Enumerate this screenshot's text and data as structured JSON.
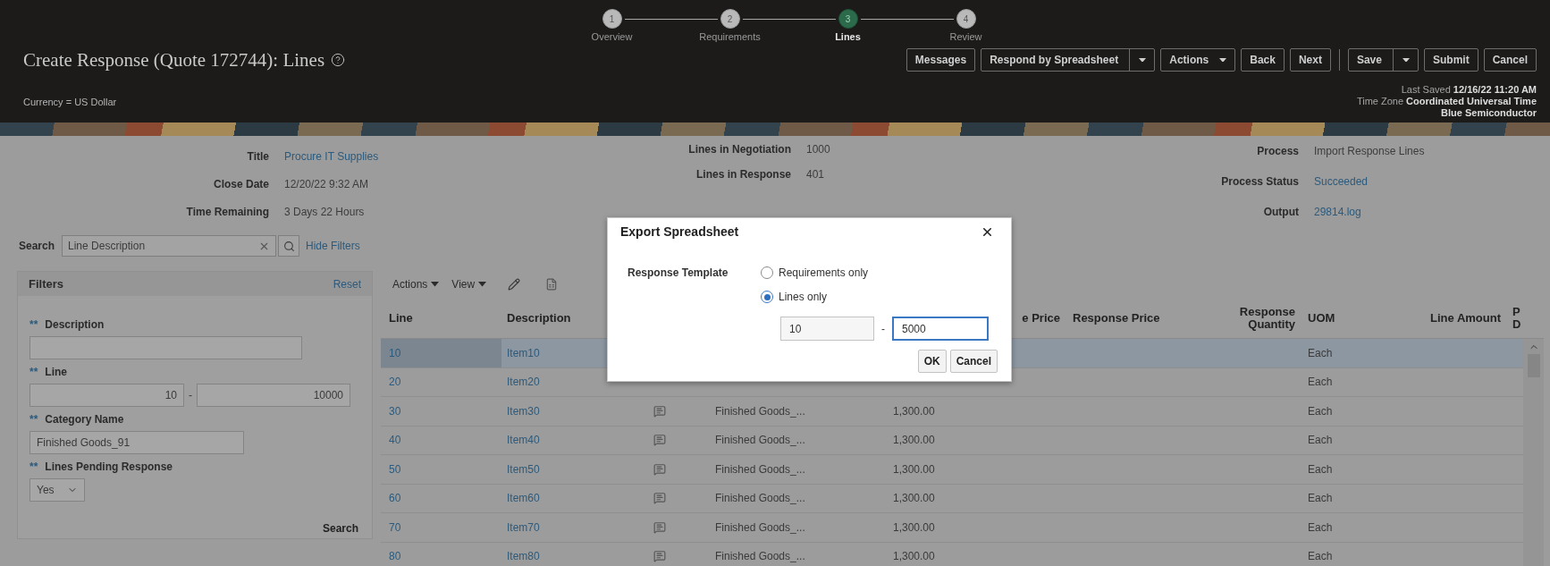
{
  "header": {
    "title": "Create Response (Quote 172744): Lines",
    "currency": "Currency = US Dollar",
    "train": [
      {
        "number": "1",
        "label": "Overview",
        "selected": false
      },
      {
        "number": "2",
        "label": "Requirements",
        "selected": false
      },
      {
        "number": "3",
        "label": "Lines",
        "selected": true
      },
      {
        "number": "4",
        "label": "Review",
        "selected": false
      }
    ],
    "toolbar": [
      {
        "kind": "button",
        "label": "Messages"
      },
      {
        "kind": "split",
        "label": "Respond by Spreadsheet"
      },
      {
        "kind": "menu",
        "label": "Actions"
      },
      {
        "kind": "button",
        "label": "Back"
      },
      {
        "kind": "button",
        "label": "Next"
      },
      {
        "kind": "separator"
      },
      {
        "kind": "split",
        "label": "Save"
      },
      {
        "kind": "button",
        "label": "Submit"
      },
      {
        "kind": "button",
        "label": "Cancel"
      }
    ],
    "last_saved": "Last Saved **12/16/22 11:20 AM**",
    "time_zone": "Time Zone **Coordinated Universal Time**",
    "supplier": "Blue Semiconductor"
  },
  "summary": {
    "left": [
      {
        "label": "Title",
        "value": "Procure IT Supplies",
        "link": true
      },
      {
        "label": "Close Date",
        "value": "12/20/22 9:32 AM",
        "link": false
      },
      {
        "label": "Time Remaining",
        "value": "3 Days 22 Hours",
        "link": false
      }
    ],
    "middle": [
      {
        "label": "Lines in Negotiation",
        "value": "1000",
        "link": false
      },
      {
        "label": "Lines in Response",
        "value": "401",
        "link": false
      }
    ],
    "right": [
      {
        "label": "Process",
        "value": "Import Response Lines",
        "link": false
      },
      {
        "label": "Process Status",
        "value": "Succeeded",
        "link": true
      },
      {
        "label": "Output",
        "value": "29814.log",
        "link": true
      }
    ]
  },
  "search": {
    "label": "Search",
    "value": "Line Description",
    "hide_filters": "Hide Filters"
  },
  "filters": {
    "title": "Filters",
    "reset": "Reset",
    "search_button": "Search",
    "fields": [
      {
        "kind": "text",
        "marker": "**",
        "label": "Description"
      },
      {
        "kind": "range",
        "marker": "**",
        "label": "Line",
        "from": "10",
        "separator": "-",
        "to": "10000"
      },
      {
        "kind": "text",
        "marker": "**",
        "label": "Category Name",
        "value": "Finished Goods_91"
      },
      {
        "kind": "select",
        "marker": "**",
        "label": "Lines Pending Response",
        "value": "Yes"
      }
    ]
  },
  "table": {
    "toolbar": [
      {
        "label": "Actions"
      },
      {
        "label": "View"
      }
    ],
    "columns": {
      "line": "Line",
      "description": "Description",
      "price": "e Price",
      "response_price": "Response Price",
      "response_quantity": "Response Quantity",
      "uom": "UOM",
      "line_amount": "Line Amount",
      "column_10": "P D"
    },
    "rows": [
      {
        "selected": true,
        "line": "10",
        "description": "Item10",
        "note": false,
        "uom": "Each"
      },
      {
        "selected": false,
        "line": "20",
        "description": "Item20",
        "note": false,
        "uom": "Each"
      },
      {
        "selected": false,
        "line": "30",
        "description": "Item30",
        "note": true,
        "category": "Finished Goods_...",
        "price": "1,300.00",
        "uom": "Each"
      },
      {
        "selected": false,
        "line": "40",
        "description": "Item40",
        "note": true,
        "category": "Finished Goods_...",
        "price": "1,300.00",
        "uom": "Each"
      },
      {
        "selected": false,
        "line": "50",
        "description": "Item50",
        "note": true,
        "category": "Finished Goods_...",
        "price": "1,300.00",
        "uom": "Each"
      },
      {
        "selected": false,
        "line": "60",
        "description": "Item60",
        "note": true,
        "category": "Finished Goods_...",
        "price": "1,300.00",
        "uom": "Each"
      },
      {
        "selected": false,
        "line": "70",
        "description": "Item70",
        "note": true,
        "category": "Finished Goods_...",
        "price": "1,300.00",
        "uom": "Each"
      },
      {
        "selected": false,
        "line": "80",
        "description": "Item80",
        "note": true,
        "category": "Finished Goods_...",
        "price": "1,300.00",
        "uom": "Each"
      }
    ]
  },
  "dialog": {
    "title": "Export Spreadsheet",
    "template_label": "Response Template",
    "options": [
      {
        "label": "Requirements only",
        "selected": false
      },
      {
        "label": "Lines only",
        "selected": true
      }
    ],
    "from": "10",
    "separator": "-",
    "to": "5000",
    "ok": "OK",
    "cancel": "Cancel"
  }
}
